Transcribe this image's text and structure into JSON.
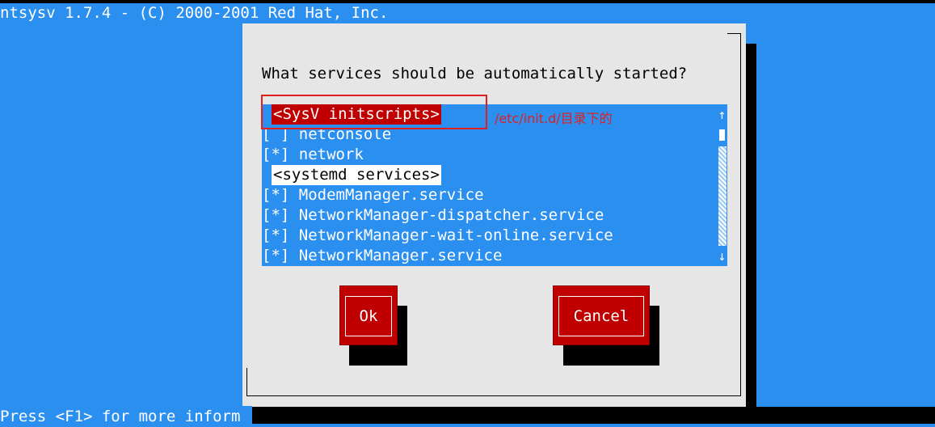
{
  "window": {
    "title": "ntsysv 1.7.4 - (C) 2000-2001 Red Hat, Inc.",
    "status_line": "Press <F1> for more inform"
  },
  "dialog": {
    "prompt": "What services should be automatically started?",
    "sections": [
      {
        "header": "<SysV initscripts>",
        "selected": true,
        "items": [
          {
            "mark": "[ ]",
            "name": "netconsole"
          },
          {
            "mark": "[*]",
            "name": "network"
          }
        ]
      },
      {
        "header": "<systemd services>",
        "selected": false,
        "items": [
          {
            "mark": "[*]",
            "name": "ModemManager.service"
          },
          {
            "mark": "[*]",
            "name": "NetworkManager-dispatcher.service"
          },
          {
            "mark": "[*]",
            "name": "NetworkManager-wait-online.service"
          },
          {
            "mark": "[*]",
            "name": "NetworkManager.service"
          }
        ]
      }
    ],
    "scroll_up_arrow": "↑",
    "scroll_down_arrow": "↓",
    "buttons": {
      "ok": "Ok",
      "cancel": "Cancel"
    }
  },
  "annotation": {
    "text": "/etc/init.d/目录下的",
    "color": "#e02020"
  },
  "colors": {
    "background": "#2b8ff0",
    "dialog": "#e6e6e6",
    "selected": "#c00000",
    "button": "#c00000"
  }
}
